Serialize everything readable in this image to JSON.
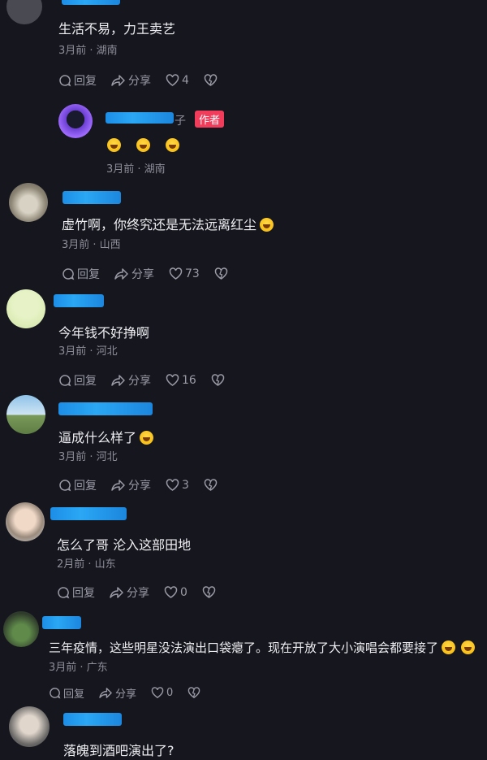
{
  "actions": {
    "reply": "回复",
    "share": "分享"
  },
  "author_badge": "作者",
  "comments": [
    {
      "text": "生活不易，力王卖艺",
      "meta": "3月前 · 湖南",
      "likes": "4"
    },
    {
      "name_tail": "子",
      "meta": "3月前 · 湖南"
    },
    {
      "text": "虚竹啊，你终究还是无法远离红尘",
      "meta": "3月前 · 山西",
      "likes": "73"
    },
    {
      "text": "今年钱不好挣啊",
      "meta": "3月前 · 河北",
      "likes": "16"
    },
    {
      "text": "逼成什么样了",
      "meta": "3月前 · 河北",
      "likes": "3"
    },
    {
      "text": "怎么了哥 沦入这部田地",
      "meta": "2月前 · 山东",
      "likes": "0"
    },
    {
      "text": "三年疫情，这些明星没法演出口袋瘪了。现在开放了大小演唱会都要接了",
      "meta": "3月前 · 广东",
      "likes": "0"
    },
    {
      "text": "落魄到酒吧演出了?"
    }
  ]
}
